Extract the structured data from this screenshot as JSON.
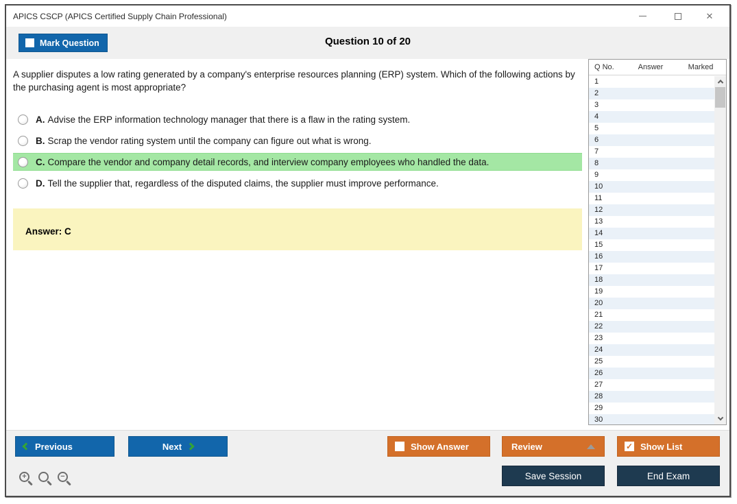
{
  "window": {
    "title": "APICS CSCP (APICS Certified Supply Chain Professional)"
  },
  "toolbar": {
    "mark_question_label": "Mark Question",
    "question_counter": "Question 10 of 20"
  },
  "question": {
    "text": "A supplier disputes a low rating generated by a company's enterprise resources planning (ERP) system. Which of the following actions by the purchasing agent is most appropriate?",
    "options": [
      {
        "letter": "A.",
        "text": "Advise the ERP information technology manager that there is a flaw in the rating system.",
        "highlighted": false
      },
      {
        "letter": "B.",
        "text": "Scrap the vendor rating system until the company can figure out what is wrong.",
        "highlighted": false
      },
      {
        "letter": "C.",
        "text": "Compare the vendor and company detail records, and interview company employees who handled the data.",
        "highlighted": true
      },
      {
        "letter": "D.",
        "text": "Tell the supplier that, regardless of the disputed claims, the supplier must improve performance.",
        "highlighted": false
      }
    ],
    "answer_label": "Answer: C"
  },
  "sidebar": {
    "columns": {
      "qno": "Q No.",
      "answer": "Answer",
      "marked": "Marked"
    },
    "row_numbers": [
      "1",
      "2",
      "3",
      "4",
      "5",
      "6",
      "7",
      "8",
      "9",
      "10",
      "11",
      "12",
      "13",
      "14",
      "15",
      "16",
      "17",
      "18",
      "19",
      "20",
      "21",
      "22",
      "23",
      "24",
      "25",
      "26",
      "27",
      "28",
      "29",
      "30"
    ]
  },
  "footer": {
    "previous_label": "Previous",
    "next_label": "Next",
    "show_answer_label": "Show Answer",
    "show_answer_checked": false,
    "review_label": "Review",
    "show_list_label": "Show List",
    "show_list_checked": true,
    "save_session_label": "Save Session",
    "end_exam_label": "End Exam"
  },
  "icons": {
    "close_glyph": "✕",
    "check_glyph": "✓",
    "plus_glyph": "+",
    "minus_glyph": "−"
  },
  "colors": {
    "accent_blue": "#1266ab",
    "accent_orange": "#d4702a",
    "accent_navy": "#1e3a50",
    "highlight_green": "#a4e7a4",
    "answer_yellow": "#faf4bf",
    "row_stripe_blue": "#eaf1f8",
    "chevron_green": "#35a435",
    "toolbar_gray": "#f0f0f0"
  }
}
